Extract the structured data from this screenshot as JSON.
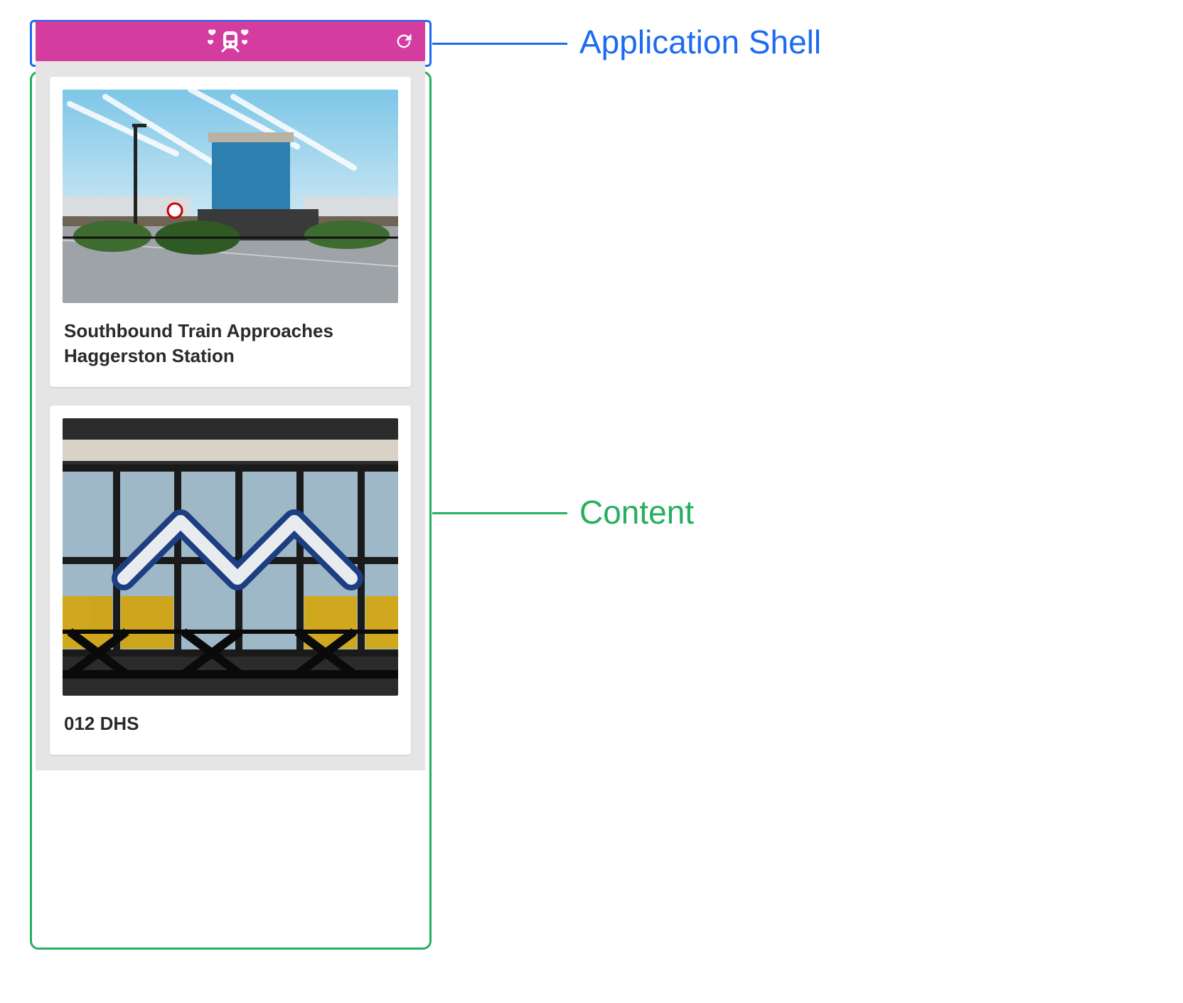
{
  "colors": {
    "accent": "#d53ca0",
    "shell_outline": "#1c6bf2",
    "content_outline": "#27ae5f"
  },
  "annotations": {
    "shell_label": "Application Shell",
    "content_label": "Content"
  },
  "app": {
    "logo_icon": "train-hearts-icon",
    "reload_icon": "reload-icon"
  },
  "cards": [
    {
      "title": "Southbound Train Approaches Haggerston Station"
    },
    {
      "title": "012 DHS"
    }
  ]
}
